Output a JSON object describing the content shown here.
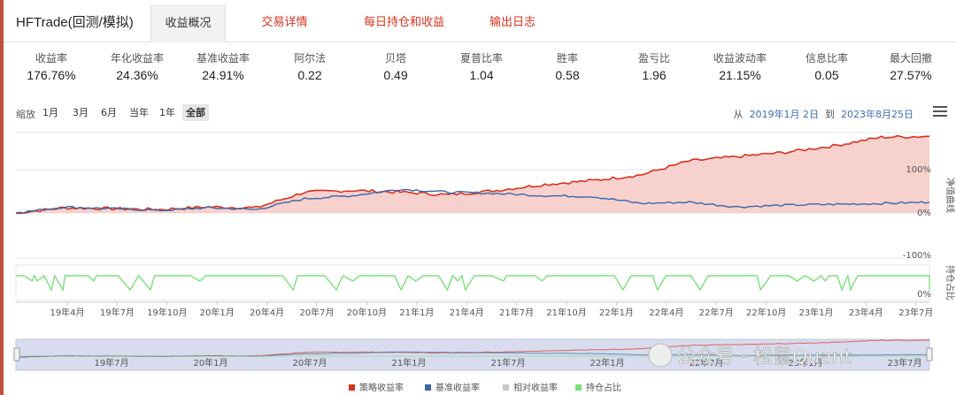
{
  "app_title": "HFTrade(回测/模拟)",
  "tabs": [
    {
      "label": "收益概况",
      "active": true
    },
    {
      "label": "交易详情",
      "active": false
    },
    {
      "label": "每日持仓和收益",
      "active": false
    },
    {
      "label": "输出日志",
      "active": false
    }
  ],
  "metrics": [
    {
      "label": "收益率",
      "value": "176.76%"
    },
    {
      "label": "年化收益率",
      "value": "24.36%"
    },
    {
      "label": "基准收益率",
      "value": "24.91%"
    },
    {
      "label": "阿尔法",
      "value": "0.22"
    },
    {
      "label": "贝塔",
      "value": "0.49"
    },
    {
      "label": "夏普比率",
      "value": "1.04"
    },
    {
      "label": "胜率",
      "value": "0.58"
    },
    {
      "label": "盈亏比",
      "value": "1.96"
    },
    {
      "label": "收益波动率",
      "value": "21.15%"
    },
    {
      "label": "信息比率",
      "value": "0.05"
    },
    {
      "label": "最大回撤",
      "value": "27.57%"
    }
  ],
  "zoom": {
    "label": "缩放",
    "buttons": [
      "1月",
      "3月",
      "6月",
      "当年",
      "1年",
      "全部"
    ],
    "active": "全部"
  },
  "date_range": {
    "from_label": "从",
    "from": "2019年1月 2日",
    "to_label": "到",
    "to": "2023年8月25日"
  },
  "colors": {
    "strategy": "#d9321e",
    "benchmark": "#3b67a8",
    "relative": "#c8c8c8",
    "position": "#7be07b",
    "area": "#f5c9c4"
  },
  "chart_data": {
    "type": "line",
    "x": [
      "2019-01",
      "2019-04",
      "2019-07",
      "2019-10",
      "2020-01",
      "2020-04",
      "2020-07",
      "2020-10",
      "2021-01",
      "2021-04",
      "2021-07",
      "2021-10",
      "2022-01",
      "2022-04",
      "2022-07",
      "2022-10",
      "2023-01",
      "2023-04",
      "2023-07",
      "2023-08"
    ],
    "series": [
      {
        "name": "策略收益率",
        "values": [
          0,
          12,
          10,
          8,
          14,
          12,
          48,
          52,
          48,
          42,
          52,
          66,
          75,
          88,
          120,
          130,
          140,
          155,
          175,
          177
        ]
      },
      {
        "name": "基准收益率",
        "values": [
          0,
          14,
          10,
          6,
          12,
          8,
          33,
          40,
          55,
          48,
          45,
          40,
          38,
          22,
          25,
          14,
          18,
          20,
          22,
          25
        ]
      },
      {
        "name": "相对收益率",
        "values": []
      },
      {
        "name": "持仓占比",
        "values": []
      }
    ],
    "y_ticks": [
      "100%",
      "0%",
      "-100%"
    ],
    "y_axis_label": "净值曲线",
    "pos_y_ticks": [
      "0%"
    ],
    "pos_axis_label": "持仓占比",
    "x_tick_labels": [
      "19年4月",
      "19年7月",
      "19年10月",
      "20年1月",
      "20年4月",
      "20年7月",
      "20年10月",
      "21年1月",
      "21年4月",
      "21年7月",
      "21年10月",
      "22年1月",
      "22年4月",
      "22年7月",
      "22年10月",
      "23年1月",
      "23年4月",
      "23年7月"
    ],
    "navigator_labels": [
      "19年7月",
      "20年1月",
      "20年7月",
      "21年1月",
      "21年7月",
      "22年1月",
      "22年7月",
      "23年1月",
      "23年7月"
    ],
    "legend": [
      "策略收益率",
      "基准收益率",
      "相对收益率",
      "持仓占比"
    ]
  },
  "watermark": "公众号 · 松鼠Quant"
}
